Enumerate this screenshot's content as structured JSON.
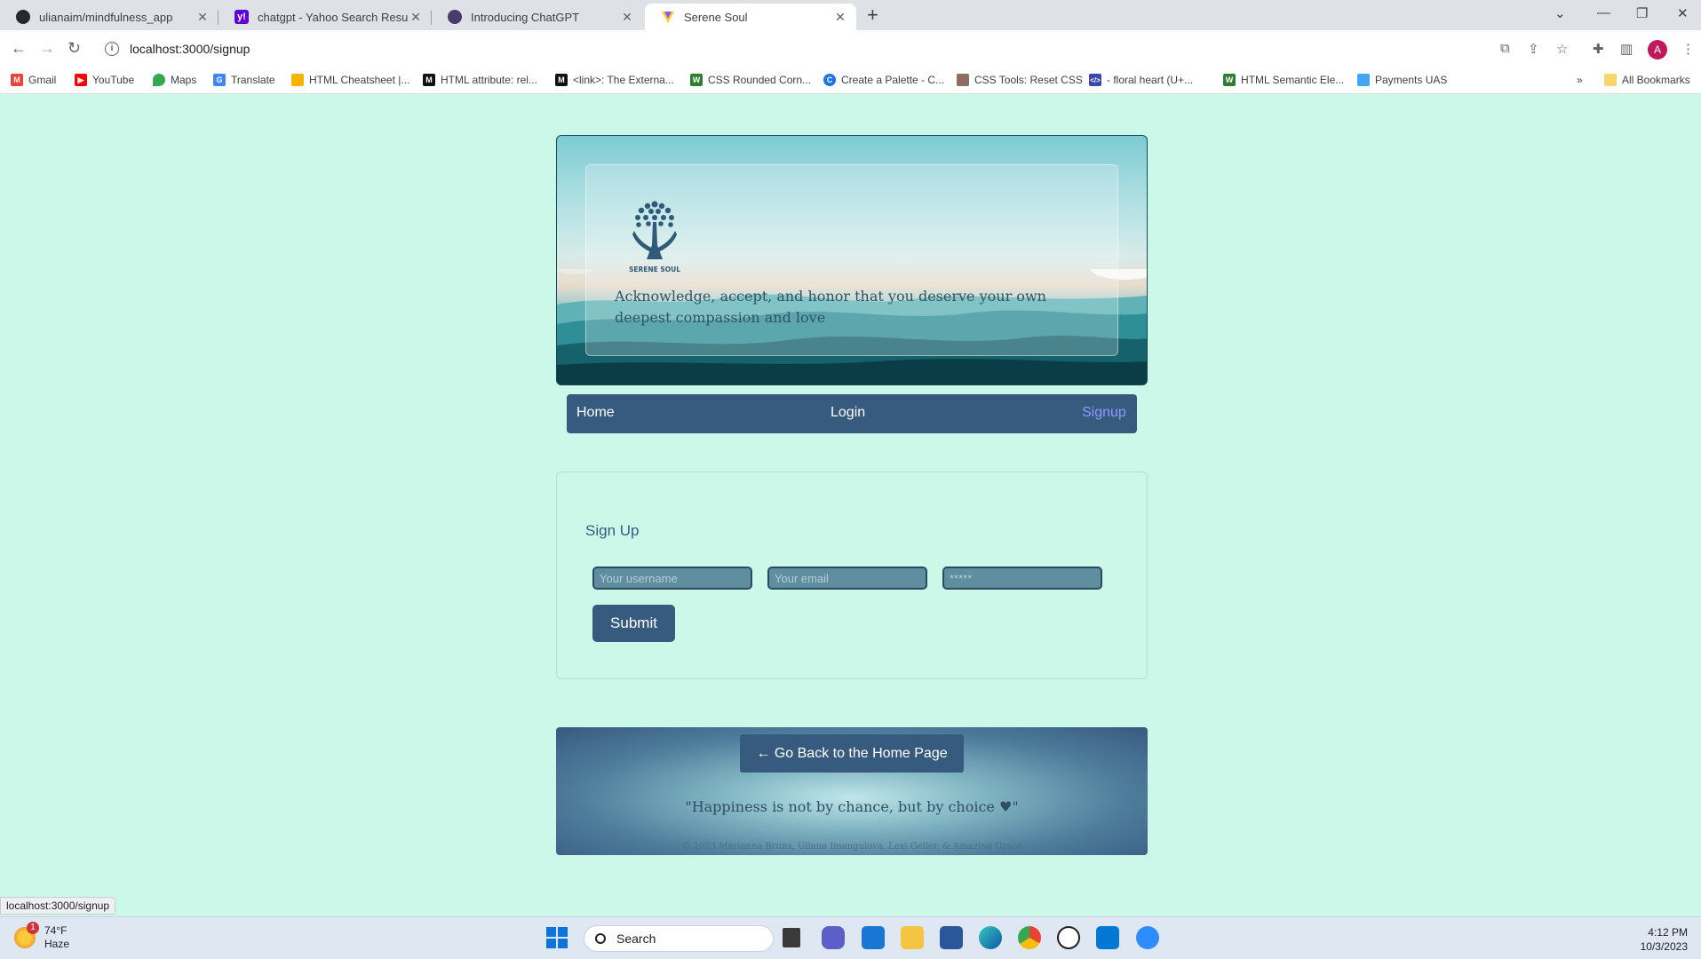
{
  "browser": {
    "tabs": [
      {
        "title": "ulianaim/mindfulness_app",
        "icon": "github-icon",
        "active": false
      },
      {
        "title": "chatgpt - Yahoo Search Results",
        "icon": "yahoo-icon",
        "active": false
      },
      {
        "title": "Introducing ChatGPT",
        "icon": "openai-icon",
        "active": false
      },
      {
        "title": "Serene Soul",
        "icon": "serene-soul-icon",
        "active": true
      }
    ],
    "url": "localhost:3000/signup",
    "profile_initial": "A",
    "bookmarks": [
      {
        "label": "Gmail",
        "color": "#ea4335"
      },
      {
        "label": "YouTube",
        "color": "#ff0000"
      },
      {
        "label": "Maps",
        "color": "#34a853"
      },
      {
        "label": "Translate",
        "color": "#4285f4"
      },
      {
        "label": "HTML Cheatsheet |...",
        "color": "#f4b400"
      },
      {
        "label": "HTML attribute: rel...",
        "color": "#111111"
      },
      {
        "label": "<link>: The Externa...",
        "color": "#111111"
      },
      {
        "label": "CSS Rounded Corn...",
        "color": "#2e7d32"
      },
      {
        "label": "Create a Palette - C...",
        "color": "#1a73e8"
      },
      {
        "label": "CSS Tools: Reset CSS",
        "color": "#8d6e63"
      },
      {
        "label": "- floral heart (U+...",
        "color": "#3949ab"
      },
      {
        "label": "HTML Semantic Ele...",
        "color": "#2e7d32"
      },
      {
        "label": "Payments UAS",
        "color": "#42a5f5"
      }
    ],
    "all_bookmarks_label": "All Bookmarks",
    "status_url": "localhost:3000/signup"
  },
  "hero": {
    "logo_text": "SERENE SOUL",
    "tagline": "Acknowledge, accept, and honor that you deserve your own deepest compassion and love"
  },
  "nav": {
    "home": "Home",
    "login": "Login",
    "signup": "Signup"
  },
  "signup": {
    "title": "Sign Up",
    "username_placeholder": "Your username",
    "email_placeholder": "Your email",
    "password_placeholder": "*****",
    "submit_label": "Submit"
  },
  "footer": {
    "back_label": "← Go Back to the Home Page",
    "quote": "\"Happiness is not by chance, but by choice ♥\"",
    "copyright": "© 2023 Marianna Bruns, Uliana Imangulova, Lexi Geller, & Amazing Grace"
  },
  "taskbar": {
    "temperature": "74°F",
    "condition": "Haze",
    "weather_badge": "1",
    "search_label": "Search",
    "time": "4:12 PM",
    "date": "10/3/2023"
  },
  "colors": {
    "page_bg": "#cbf8e8",
    "nav_bg": "#375a7f",
    "active_link": "#8e9bff"
  }
}
